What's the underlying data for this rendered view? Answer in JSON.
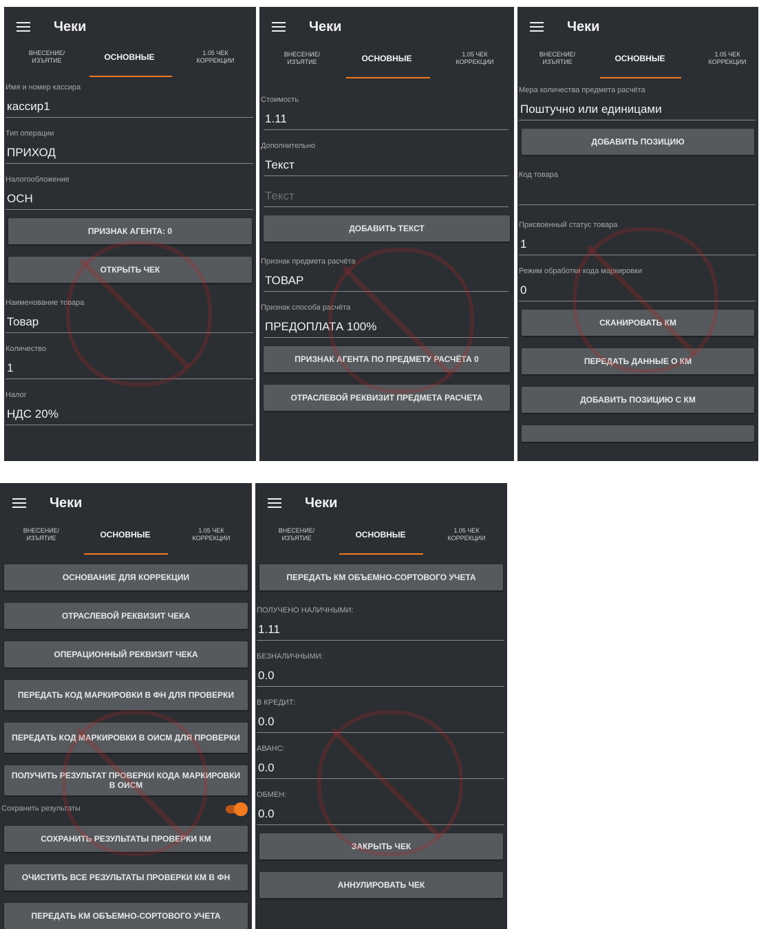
{
  "app": {
    "title": "Чеки",
    "tabs": [
      "Внесение/ изъятие",
      "Основные",
      "1.05 чек коррекции"
    ]
  },
  "panel1": {
    "fields": [
      {
        "label": "Имя и номер кассира",
        "value": "кассир1"
      },
      {
        "label": "Тип операции",
        "value": "ПРИХОД"
      },
      {
        "label": "Налогообложение",
        "value": "ОСН"
      }
    ],
    "buttons": [
      "ПРИЗНАК АГЕНТА: 0",
      "ОТКРЫТЬ ЧЕК"
    ],
    "fields2": [
      {
        "label": "Наименование товара",
        "value": "Товар"
      },
      {
        "label": "Количество",
        "value": "1"
      },
      {
        "label": "Налог",
        "value": "НДС 20%"
      }
    ]
  },
  "panel2": {
    "cost_label": "Стоимость",
    "cost_value": "1.11",
    "extra_label": "Дополнительно",
    "extra_value": "Текст",
    "extra_placeholder": "Текст",
    "add_text_button": "ДОБАВИТЬ ТЕКСТ",
    "subject_label": "Признак предмета расчёта",
    "subject_value": "ТОВАР",
    "method_label": "Признак способа расчёта",
    "method_value": "ПРЕДОПЛАТА 100%",
    "buttons": [
      "ПРИЗНАК АГЕНТА ПО ПРЕДМЕТУ РАСЧЁТА 0",
      "ОТРАСЛЕВОЙ РЕКВИЗИТ ПРЕДМЕТА РАСЧЕТА"
    ]
  },
  "panel3": {
    "measure_label": "Мера количества предмета расчёта",
    "measure_value": "Поштучно или единицами",
    "add_position_button": "ДОБАВИТЬ ПОЗИЦИЮ",
    "code_label": "Код товара",
    "code_value": "",
    "status_label": "Присвоенный статус товара",
    "status_value": "1",
    "mode_label": "Режим обработки кода маркировки",
    "mode_value": "0",
    "buttons": [
      "СКАНИРОВАТЬ КМ",
      "ПЕРЕДАТЬ ДАННЫЕ О КМ",
      "ДОБАВИТЬ ПОЗИЦИЮ С КМ"
    ]
  },
  "panel4": {
    "buttons_top": [
      "ОСНОВАНИЕ ДЛЯ КОРРЕКЦИИ",
      "ОТРАСЛЕВОЙ РЕКВИЗИТ ЧЕКА",
      "ОПЕРАЦИОННЫЙ РЕКВИЗИТ ЧЕКА",
      "ПЕРЕДАТЬ КОД МАРКИРОВКИ В ФН ДЛЯ ПРОВЕРКИ",
      "ПЕРЕДАТЬ КОД МАРКИРОВКИ В ОИСМ ДЛЯ ПРОВЕРКИ",
      "ПОЛУЧИТЬ РЕЗУЛЬТАТ ПРОВЕРКИ КОДА МАРКИРОВКИ В ОИСМ"
    ],
    "save_label": "Сохранить результаты",
    "save_toggle_on": true,
    "buttons_bottom": [
      "СОХРАНИТЬ РЕЗУЛЬТАТЫ ПРОВЕРКИ КМ",
      "ОЧИСТИТЬ ВСЕ РЕЗУЛЬТАТЫ ПРОВЕРКИ КМ В ФН",
      "ПЕРЕДАТЬ КМ ОБЪЕМНО-СОРТОВОГО УЧЕТА"
    ]
  },
  "panel5": {
    "top_button": "ПЕРЕДАТЬ КМ ОБЪЕМНО-СОРТОВОГО УЧЕТА",
    "fields": [
      {
        "label": "ПОЛУЧЕНО НАЛИЧНЫМИ:",
        "value": "1.11"
      },
      {
        "label": "БЕЗНАЛИЧНЫМИ:",
        "value": "0.0"
      },
      {
        "label": "В КРЕДИТ:",
        "value": "0.0"
      },
      {
        "label": "АВАНС:",
        "value": "0.0"
      },
      {
        "label": "ОБМЕН:",
        "value": "0.0"
      }
    ],
    "buttons": [
      "ЗАКРЫТЬ ЧЕК",
      "АННУЛИРОВАТЬ ЧЕК"
    ]
  },
  "colors": {
    "accent": "#f47a20",
    "background": "#2b2e32",
    "button": "#565a5e"
  }
}
